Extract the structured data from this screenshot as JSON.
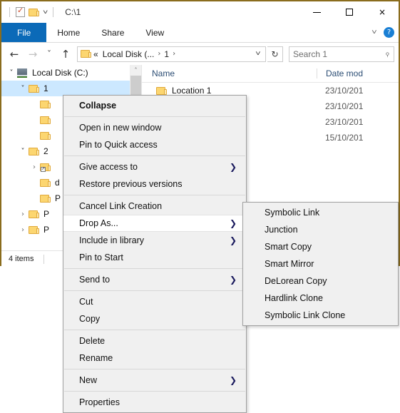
{
  "window": {
    "title": "C:\\1",
    "quick_access": {
      "properties_icon": "properties-checkmark-icon",
      "new_folder_icon": "new-folder-icon",
      "customize_caret": "chevron-down-icon"
    },
    "controls": {
      "minimize": "minimize-icon",
      "maximize": "maximize-icon",
      "close": "×"
    }
  },
  "ribbon": {
    "tabs": [
      {
        "label": "File",
        "active": true
      },
      {
        "label": "Home",
        "active": false
      },
      {
        "label": "Share",
        "active": false
      },
      {
        "label": "View",
        "active": false
      }
    ],
    "expand_caret": "chevron-down-icon",
    "help_label": "?"
  },
  "addressbar": {
    "back": "←",
    "forward": "→",
    "recent": "chevron-down-icon",
    "up": "↑",
    "breadcrumb": [
      {
        "label": "«",
        "sep": ""
      },
      {
        "label": "Local Disk (...",
        "sep": "›"
      },
      {
        "label": "1",
        "sep": "›"
      }
    ],
    "dropdown_caret": "chevron-down-icon",
    "refresh": "↻"
  },
  "search": {
    "placeholder": "Search 1",
    "icon": "search-icon"
  },
  "navpane": {
    "items": [
      {
        "label": "Local Disk (C:)",
        "indent": 0,
        "chevron": "˅",
        "icon": "drive",
        "selected": false
      },
      {
        "label": "1",
        "indent": 1,
        "chevron": "˅",
        "icon": "folder",
        "selected": true
      },
      {
        "label": "",
        "indent": 2,
        "chevron": "",
        "icon": "folder",
        "selected": false
      },
      {
        "label": "",
        "indent": 2,
        "chevron": "",
        "icon": "folder",
        "selected": false
      },
      {
        "label": "",
        "indent": 2,
        "chevron": "",
        "icon": "folder",
        "selected": false
      },
      {
        "label": "2",
        "indent": 1,
        "chevron": "˅",
        "icon": "folder",
        "selected": false
      },
      {
        "label": "",
        "indent": 2,
        "chevron": "›",
        "icon": "folder-shortcut",
        "selected": false
      },
      {
        "label": "d",
        "indent": 2,
        "chevron": "",
        "icon": "folder",
        "selected": false
      },
      {
        "label": "P",
        "indent": 2,
        "chevron": "",
        "icon": "folder",
        "selected": false
      },
      {
        "label": "P",
        "indent": 1,
        "chevron": "›",
        "icon": "folder",
        "selected": false
      },
      {
        "label": "P",
        "indent": 1,
        "chevron": "›",
        "icon": "folder",
        "selected": false
      }
    ],
    "scroll_up": "˄",
    "scroll_down": "˅"
  },
  "filelist": {
    "columns": [
      {
        "label": "Name",
        "sorted": true,
        "sort_caret": "˄"
      },
      {
        "label": "Date mod"
      }
    ],
    "rows": [
      {
        "name": "Location 1",
        "date": "23/10/201"
      },
      {
        "name": "",
        "date": "23/10/201"
      },
      {
        "name": "",
        "date": "23/10/201"
      },
      {
        "name": "",
        "date": "15/10/201"
      }
    ]
  },
  "statusbar": {
    "item_count": "4 items"
  },
  "context_menu": {
    "groups": [
      [
        {
          "label": "Collapse",
          "bold": true,
          "submenu": false,
          "hovered": false
        }
      ],
      [
        {
          "label": "Open in new window",
          "bold": false,
          "submenu": false,
          "hovered": false
        },
        {
          "label": "Pin to Quick access",
          "bold": false,
          "submenu": false,
          "hovered": false
        }
      ],
      [
        {
          "label": "Give access to",
          "bold": false,
          "submenu": true,
          "hovered": false
        },
        {
          "label": "Restore previous versions",
          "bold": false,
          "submenu": false,
          "hovered": false
        }
      ],
      [
        {
          "label": "Cancel Link Creation",
          "bold": false,
          "submenu": false,
          "hovered": false
        },
        {
          "label": "Drop As...",
          "bold": false,
          "submenu": true,
          "hovered": true
        },
        {
          "label": "Include in library",
          "bold": false,
          "submenu": true,
          "hovered": false
        },
        {
          "label": "Pin to Start",
          "bold": false,
          "submenu": false,
          "hovered": false
        }
      ],
      [
        {
          "label": "Send to",
          "bold": false,
          "submenu": true,
          "hovered": false
        }
      ],
      [
        {
          "label": "Cut",
          "bold": false,
          "submenu": false,
          "hovered": false
        },
        {
          "label": "Copy",
          "bold": false,
          "submenu": false,
          "hovered": false
        }
      ],
      [
        {
          "label": "Delete",
          "bold": false,
          "submenu": false,
          "hovered": false
        },
        {
          "label": "Rename",
          "bold": false,
          "submenu": false,
          "hovered": false
        }
      ],
      [
        {
          "label": "New",
          "bold": false,
          "submenu": true,
          "hovered": false
        }
      ],
      [
        {
          "label": "Properties",
          "bold": false,
          "submenu": false,
          "hovered": false
        }
      ]
    ],
    "submenu_arrow": "❯"
  },
  "submenu": {
    "title": "Drop As...",
    "items": [
      {
        "label": "Symbolic Link"
      },
      {
        "label": "Junction"
      },
      {
        "label": "Smart Copy"
      },
      {
        "label": "Smart Mirror"
      },
      {
        "label": "DeLorean Copy"
      },
      {
        "label": "Hardlink Clone"
      },
      {
        "label": "Symbolic Link Clone"
      }
    ]
  },
  "colors": {
    "window_border": "#8a6c1d",
    "file_tab": "#0b6ab8",
    "selection": "#cce8ff",
    "menu_bg": "#f0f0f0",
    "column_header_text": "#2a4c73"
  }
}
